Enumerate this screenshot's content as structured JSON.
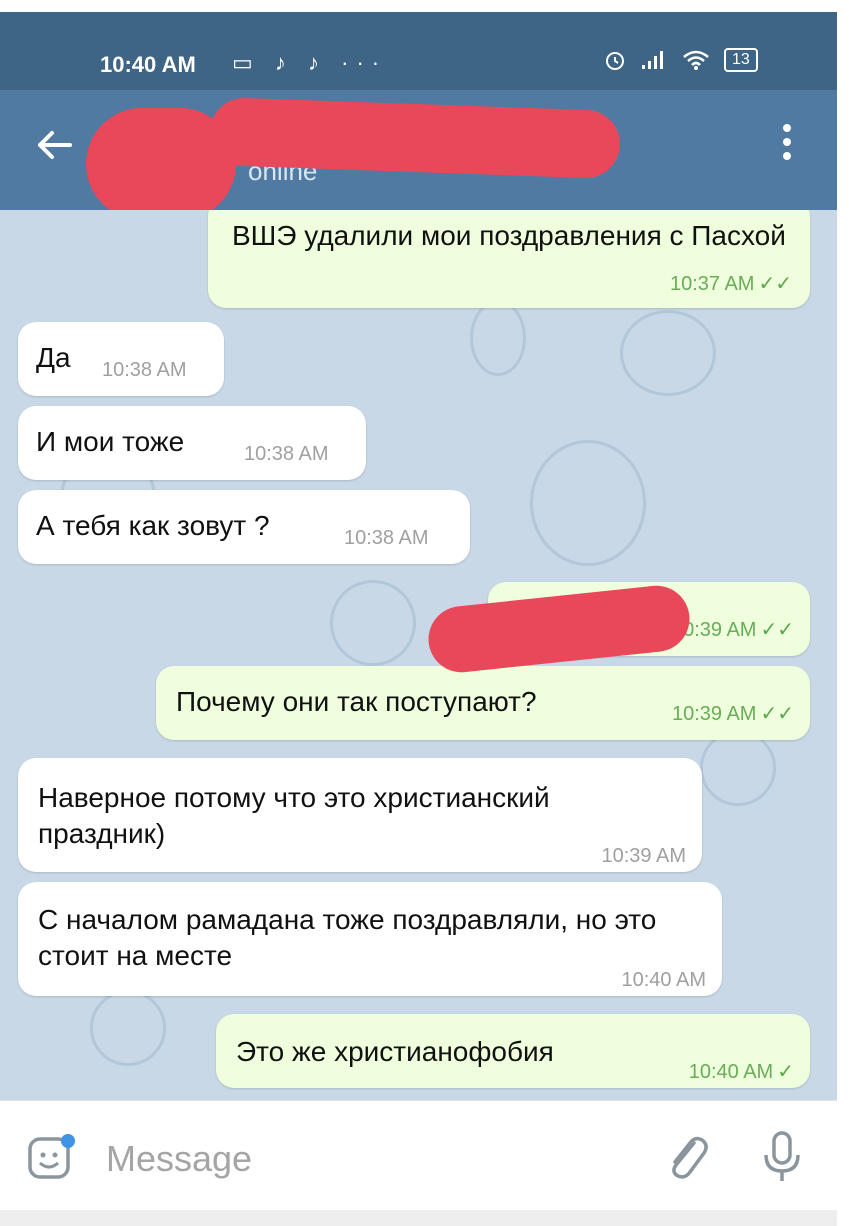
{
  "status_bar": {
    "time": "10:40 AM",
    "left_icons": "▭ ♪ ♪ ···",
    "battery": "13",
    "alarm_icon": "alarm-icon",
    "signal_icon": "signal-icon",
    "wifi_icon": "wifi-icon"
  },
  "header": {
    "status": "online",
    "back_icon": "arrow-left-icon",
    "menu_icon": "more-vertical-icon"
  },
  "messages": [
    {
      "side": "out",
      "text": "ВШЭ удалили мои поздравления с Пасхой",
      "time": "10:37 AM",
      "ticks": "✓✓"
    },
    {
      "side": "in",
      "text": "Да",
      "time": "10:38 AM"
    },
    {
      "side": "in",
      "text": "И мои тоже",
      "time": "10:38 AM"
    },
    {
      "side": "in",
      "text": "А тебя как зовут ?",
      "time": "10:38 AM"
    },
    {
      "side": "out",
      "text": "",
      "time": "10:39 AM",
      "ticks": "✓✓"
    },
    {
      "side": "out",
      "text": "Почему они так поступают?",
      "time": "10:39 AM",
      "ticks": "✓✓"
    },
    {
      "side": "in",
      "text": "Наверное потому что это христианский праздник)",
      "time": "10:39 AM"
    },
    {
      "side": "in",
      "text": "С началом рамадана тоже поздравляли, но это стоит на месте",
      "time": "10:40 AM"
    },
    {
      "side": "out",
      "text": "Это же христианофобия",
      "time": "10:40 AM",
      "ticks": "✓"
    }
  ],
  "input": {
    "placeholder": "Message",
    "sticker_icon": "sticker-icon",
    "attach_icon": "paperclip-icon",
    "mic_icon": "microphone-icon"
  },
  "colors": {
    "header": "#507aa2",
    "status_bar": "#3f6586",
    "chat_background": "#c8d8e6",
    "outgoing_bubble": "#effedd",
    "incoming_bubble": "#ffffff",
    "redaction": "#e8485a"
  }
}
